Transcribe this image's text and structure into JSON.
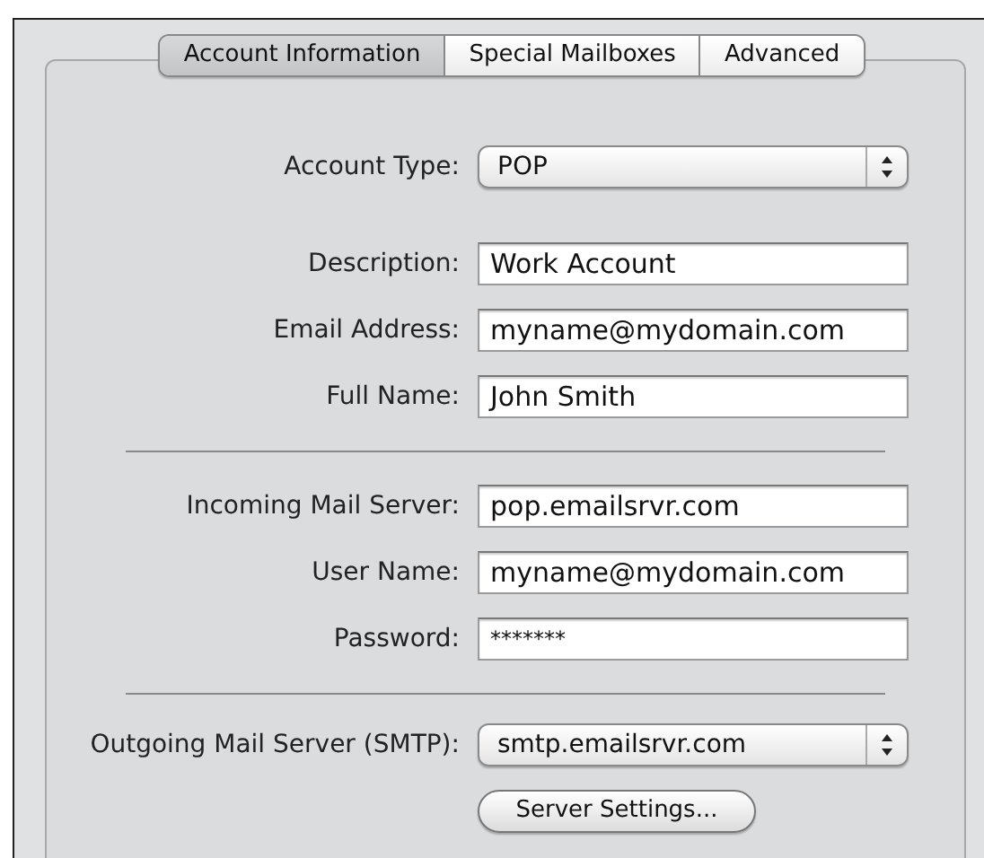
{
  "tabs": [
    {
      "label": "Account Information",
      "selected": true
    },
    {
      "label": "Special Mailboxes",
      "selected": false
    },
    {
      "label": "Advanced",
      "selected": false
    }
  ],
  "sections": [
    {
      "rows": [
        {
          "kind": "popup",
          "label": "Account Type:",
          "value": "POP"
        }
      ]
    },
    {
      "rows": [
        {
          "kind": "field",
          "label": "Description:",
          "value": "Work Account"
        },
        {
          "kind": "field",
          "label": "Email Address:",
          "value": "myname@mydomain.com"
        },
        {
          "kind": "field",
          "label": "Full Name:",
          "value": "John Smith"
        }
      ]
    },
    {
      "rows": [
        {
          "kind": "field",
          "label": "Incoming Mail Server:",
          "value": "pop.emailsrvr.com"
        },
        {
          "kind": "field",
          "label": "User Name:",
          "value": "myname@mydomain.com"
        },
        {
          "kind": "password",
          "label": "Password:",
          "value": "*******"
        }
      ]
    },
    {
      "rows": [
        {
          "kind": "popup",
          "label": "Outgoing Mail Server (SMTP):",
          "value": "smtp.emailsrvr.com"
        }
      ],
      "button": "Server Settings..."
    }
  ]
}
